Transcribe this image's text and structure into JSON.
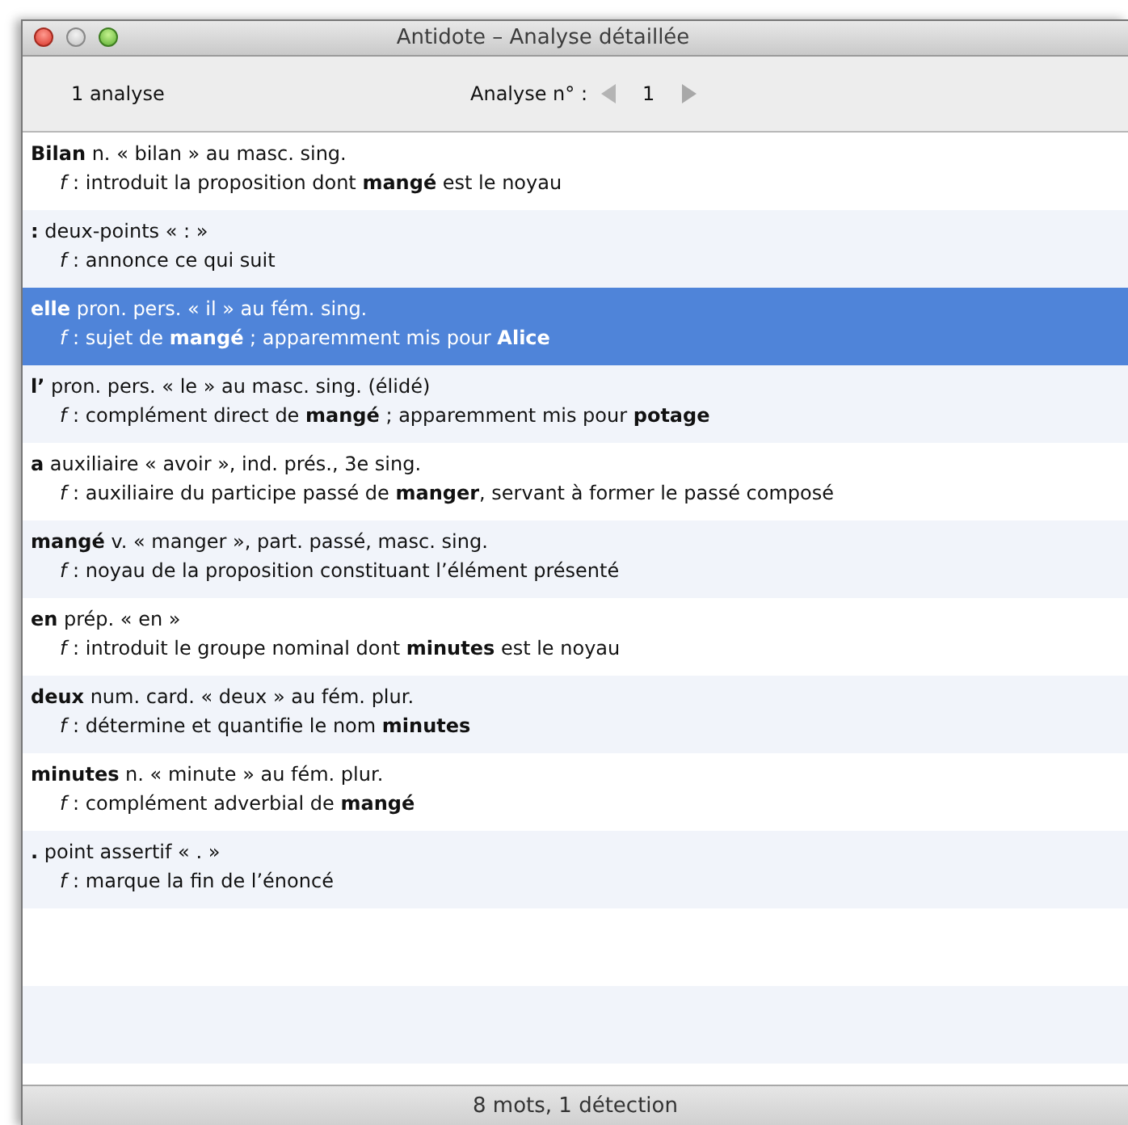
{
  "window": {
    "title": "Antidote – Analyse détaillée"
  },
  "toolbar": {
    "count": "1 analyse",
    "analysis_label": "Analyse n° :",
    "analysis_number": "1"
  },
  "rows": [
    {
      "head": "**Bilan** n. « bilan » au masc. sing.",
      "function": "*f* : introduit la proposition dont **mangé** est le noyau",
      "selected": false
    },
    {
      "head": "**:** deux-points «  : »",
      "function": "*f* : annonce ce qui suit",
      "selected": false
    },
    {
      "head": "**elle** pron. pers. « il » au fém. sing.",
      "function": "*f* : sujet de **mangé** ; apparemment mis pour **Alice**",
      "selected": true
    },
    {
      "head": "**l’** pron. pers. « le » au masc. sing. (élidé)",
      "function": "*f* : complément direct de **mangé** ; apparemment mis pour **potage**",
      "selected": false
    },
    {
      "head": "**a** auxiliaire « avoir », ind. prés., 3e sing.",
      "function": "*f* : auxiliaire du participe passé de **manger**, servant à former le passé composé",
      "selected": false
    },
    {
      "head": "**mangé** v. « manger », part. passé, masc. sing.",
      "function": "*f* : noyau de la proposition constituant l’élément présenté",
      "selected": false
    },
    {
      "head": "**en** prép. « en »",
      "function": "*f* : introduit le groupe nominal dont **minutes** est le noyau",
      "selected": false
    },
    {
      "head": "**deux** num. card. « deux » au fém. plur.",
      "function": "*f* : détermine et quantifie le nom **minutes**",
      "selected": false
    },
    {
      "head": "**minutes** n. « minute » au fém. plur.",
      "function": "*f* : complément adverbial de **mangé**",
      "selected": false
    },
    {
      "head": "**.** point assertif « . »",
      "function": "*f* : marque la fin de l’énoncé",
      "selected": false
    }
  ],
  "status_bar": "8 mots, 1 détection"
}
